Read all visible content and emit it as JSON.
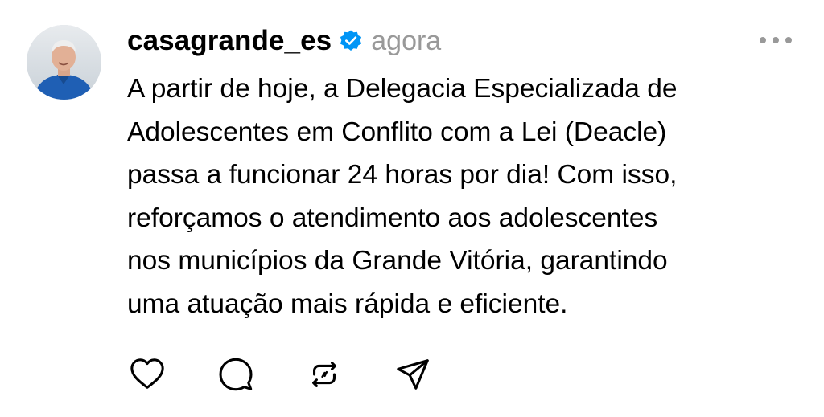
{
  "post": {
    "author": {
      "username": "casagrande_es",
      "verified": true,
      "avatar_icon": "profile-photo"
    },
    "timestamp": "agora",
    "text_lines": [
      "A partir de hoje, a Delegacia Especializada de",
      "Adolescentes em Conflito com a Lei (Deacle)",
      "passa a funcionar 24 horas por dia! Com isso,",
      "reforçamos o atendimento aos adolescentes",
      "nos municípios da Grande Vitória, garantindo",
      "uma atuação mais rápida e eficiente."
    ],
    "actions": [
      {
        "icon": "heart-icon"
      },
      {
        "icon": "comment-icon"
      },
      {
        "icon": "repost-icon"
      },
      {
        "icon": "share-icon"
      }
    ],
    "more_icon": "more-options-icon"
  },
  "colors": {
    "text": "#000000",
    "secondary_text": "#999999",
    "verified_badge": "#0095F6",
    "background": "#ffffff"
  }
}
